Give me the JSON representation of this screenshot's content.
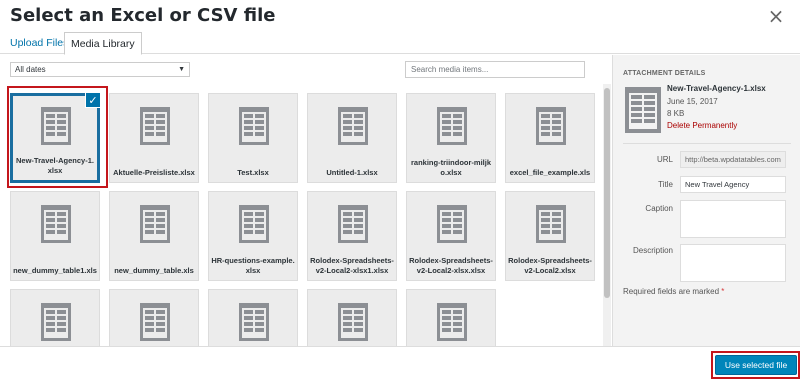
{
  "modal": {
    "title": "Select an Excel or CSV file",
    "close_glyph": "×"
  },
  "tabs": [
    {
      "label": "Upload Files",
      "active": false
    },
    {
      "label": "Media Library",
      "active": true
    }
  ],
  "filter": {
    "selected": "All dates"
  },
  "search": {
    "placeholder": "Search media items..."
  },
  "files": [
    {
      "name": "New-Travel-Agency-1.xlsx",
      "selected": true
    },
    {
      "name": "Aktuelle-Preisliste.xlsx",
      "selected": false
    },
    {
      "name": "Test.xlsx",
      "selected": false
    },
    {
      "name": "Untitled-1.xlsx",
      "selected": false
    },
    {
      "name": "ranking-triindoor-miljko.xlsx",
      "selected": false
    },
    {
      "name": "excel_file_example.xls",
      "selected": false
    },
    {
      "name": "new_dummy_table1.xls",
      "selected": false
    },
    {
      "name": "new_dummy_table.xls",
      "selected": false
    },
    {
      "name": "HR-questions-example.xlsx",
      "selected": false
    },
    {
      "name": "Rolodex-Spreadsheets-v2-Local2-xlsx1.xlsx",
      "selected": false
    },
    {
      "name": "Rolodex-Spreadsheets-v2-Local2-xlsx.xlsx",
      "selected": false
    },
    {
      "name": "Rolodex-Spreadsheets-v2-Local2.xlsx",
      "selected": false
    },
    {
      "name": "",
      "selected": false
    },
    {
      "name": "",
      "selected": false
    },
    {
      "name": "",
      "selected": false
    },
    {
      "name": "",
      "selected": false
    },
    {
      "name": "",
      "selected": false
    }
  ],
  "details": {
    "heading": "ATTACHMENT DETAILS",
    "filename": "New-Travel-Agency-1.xlsx",
    "date": "June 15, 2017",
    "size": "8 KB",
    "delete_label": "Delete Permanently",
    "url_label": "URL",
    "url_value": "http://beta.wpdatatables.com",
    "title_label": "Title",
    "title_value": "New Travel Agency",
    "caption_label": "Caption",
    "caption_value": "",
    "description_label": "Description",
    "description_value": "",
    "required_note": "Required fields are marked",
    "required_star": "*"
  },
  "footer": {
    "use_button": "Use selected file"
  },
  "colors": {
    "accent": "#0073aa",
    "button": "#0085ba",
    "highlight": "#c4161c",
    "danger": "#aa0000"
  },
  "icons": {
    "file": "spreadsheet-document-icon",
    "check": "checkmark-icon",
    "close": "close-icon",
    "caret": "chevron-down-icon"
  }
}
